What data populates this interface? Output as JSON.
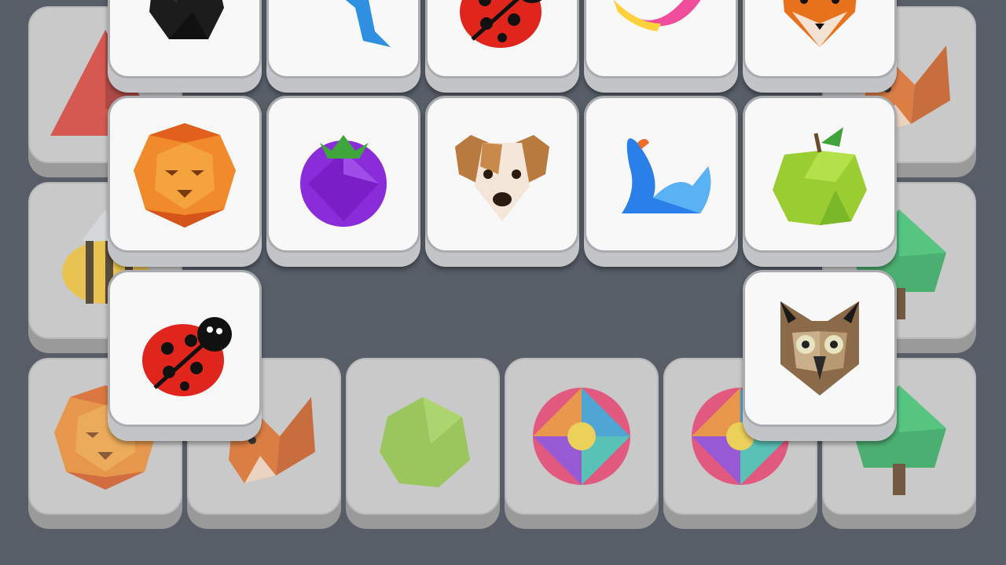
{
  "game": {
    "title": "",
    "colors": {
      "background": "#575e68",
      "tile_face_top": "#f8f8f8",
      "tile_face_bottom": "#c9c9c9"
    }
  },
  "tiles": [
    {
      "layer": "bottom",
      "icon": "wolf-icon",
      "row": 0,
      "col": 0
    },
    {
      "layer": "bottom",
      "icon": "squirrel-icon",
      "row": 0,
      "col": 5
    },
    {
      "layer": "bottom",
      "icon": "bee-icon",
      "row": 1,
      "col": 0
    },
    {
      "layer": "bottom",
      "icon": "tree-icon",
      "row": 1,
      "col": 5
    },
    {
      "layer": "bottom",
      "icon": "lion-icon",
      "row": 2,
      "col": 0
    },
    {
      "layer": "bottom",
      "icon": "squirrel-icon",
      "row": 2,
      "col": 1
    },
    {
      "layer": "bottom",
      "icon": "penguin-icon",
      "row": 2,
      "col": 4
    },
    {
      "layer": "bottom",
      "icon": "owl-icon",
      "row": 2,
      "col": 5
    },
    {
      "layer": "middle",
      "icon": "lemon-icon",
      "row": 1,
      "col": 1
    },
    {
      "layer": "middle",
      "icon": "flower-icon",
      "row": 1,
      "col": 2
    },
    {
      "layer": "middle",
      "icon": "flower-icon",
      "row": 1,
      "col": 3
    },
    {
      "layer": "middle",
      "icon": "tree-icon",
      "row": 1,
      "col": 4
    },
    {
      "layer": "top",
      "icon": "blackberry-icon",
      "row": 0,
      "col": 0
    },
    {
      "layer": "top",
      "icon": "dolphin-icon",
      "row": 0,
      "col": 1
    },
    {
      "layer": "top",
      "icon": "ladybug-icon",
      "row": 0,
      "col": 2
    },
    {
      "layer": "top",
      "icon": "banana-icon",
      "row": 0,
      "col": 3
    },
    {
      "layer": "top",
      "icon": "fox-icon",
      "row": 0,
      "col": 4
    },
    {
      "layer": "top",
      "icon": "lion-icon",
      "row": 1,
      "col": 0
    },
    {
      "layer": "top",
      "icon": "plum-icon",
      "row": 1,
      "col": 1
    },
    {
      "layer": "top",
      "icon": "puppy-icon",
      "row": 1,
      "col": 2
    },
    {
      "layer": "top",
      "icon": "swan-icon",
      "row": 1,
      "col": 3
    },
    {
      "layer": "top",
      "icon": "apple-icon",
      "row": 1,
      "col": 4
    },
    {
      "layer": "top",
      "icon": "ladybug-icon",
      "row": 2,
      "col": 0
    },
    {
      "layer": "top",
      "icon": "owl-icon",
      "row": 2,
      "col": 4
    }
  ]
}
